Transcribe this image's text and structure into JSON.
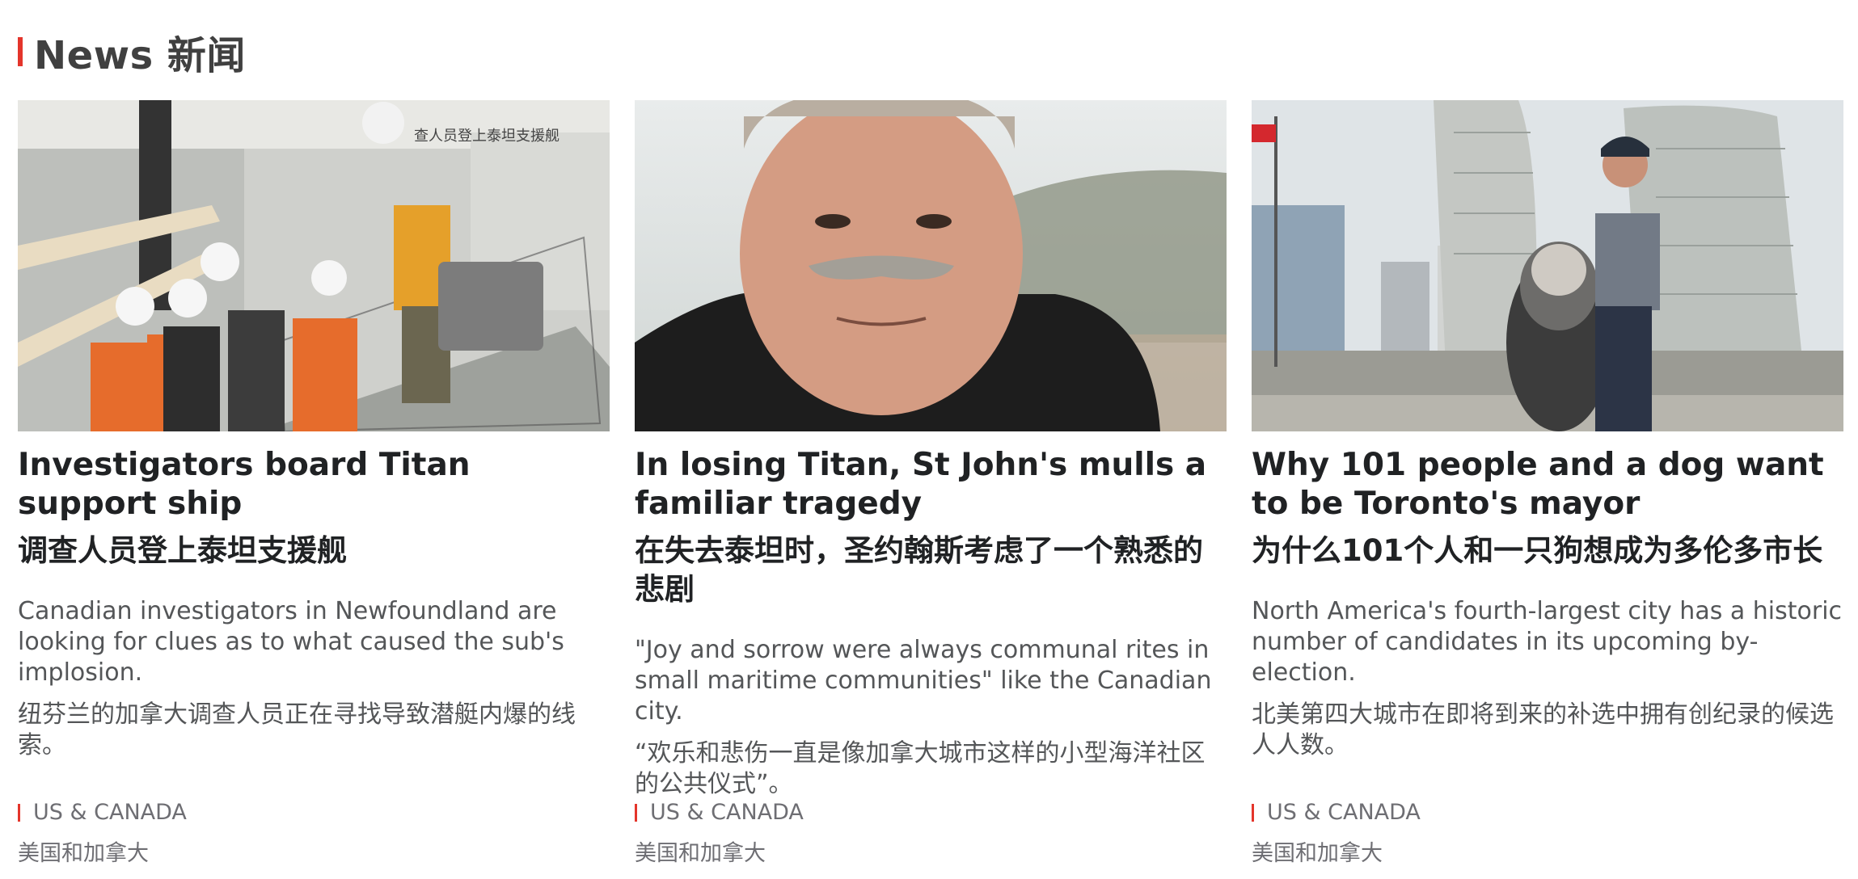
{
  "section": {
    "title": "News 新闻",
    "accent_color": "#e4352b"
  },
  "cards": [
    {
      "image_overlay_text": "查人员登上泰坦支援舰",
      "headline_en": "Investigators board Titan support ship",
      "headline_zh": "调查人员登上泰坦支援舰",
      "summary_en": "Canadian investigators in Newfoundland are looking for clues as to what caused the sub's implosion.",
      "summary_zh": "纽芬兰的加拿大调查人员正在寻找导致潜艇内爆的线索。",
      "tag_en": "US & CANADA",
      "tag_zh": "美国和加拿大"
    },
    {
      "headline_en": "In losing Titan, St John's mulls a familiar tragedy",
      "headline_zh": "在失去泰坦时，圣约翰斯考虑了一个熟悉的悲剧",
      "summary_en": "\"Joy and sorrow were always communal rites in small maritime communities\" like the Canadian city.",
      "summary_zh": "“欢乐和悲伤一直是像加拿大城市这样的小型海洋社区的公共仪式”。",
      "tag_en": "US & CANADA",
      "tag_zh": "美国和加拿大"
    },
    {
      "headline_en": "Why 101 people and a dog want to be Toronto's mayor",
      "headline_zh": "为什么101个人和一只狗想成为多伦多市长",
      "summary_en": "North America's fourth-largest city has a historic number of candidates in its upcoming by-election.",
      "summary_zh": "北美第四大城市在即将到来的补选中拥有创纪录的候选人人数。",
      "tag_en": "US & CANADA",
      "tag_zh": "美国和加拿大"
    }
  ]
}
